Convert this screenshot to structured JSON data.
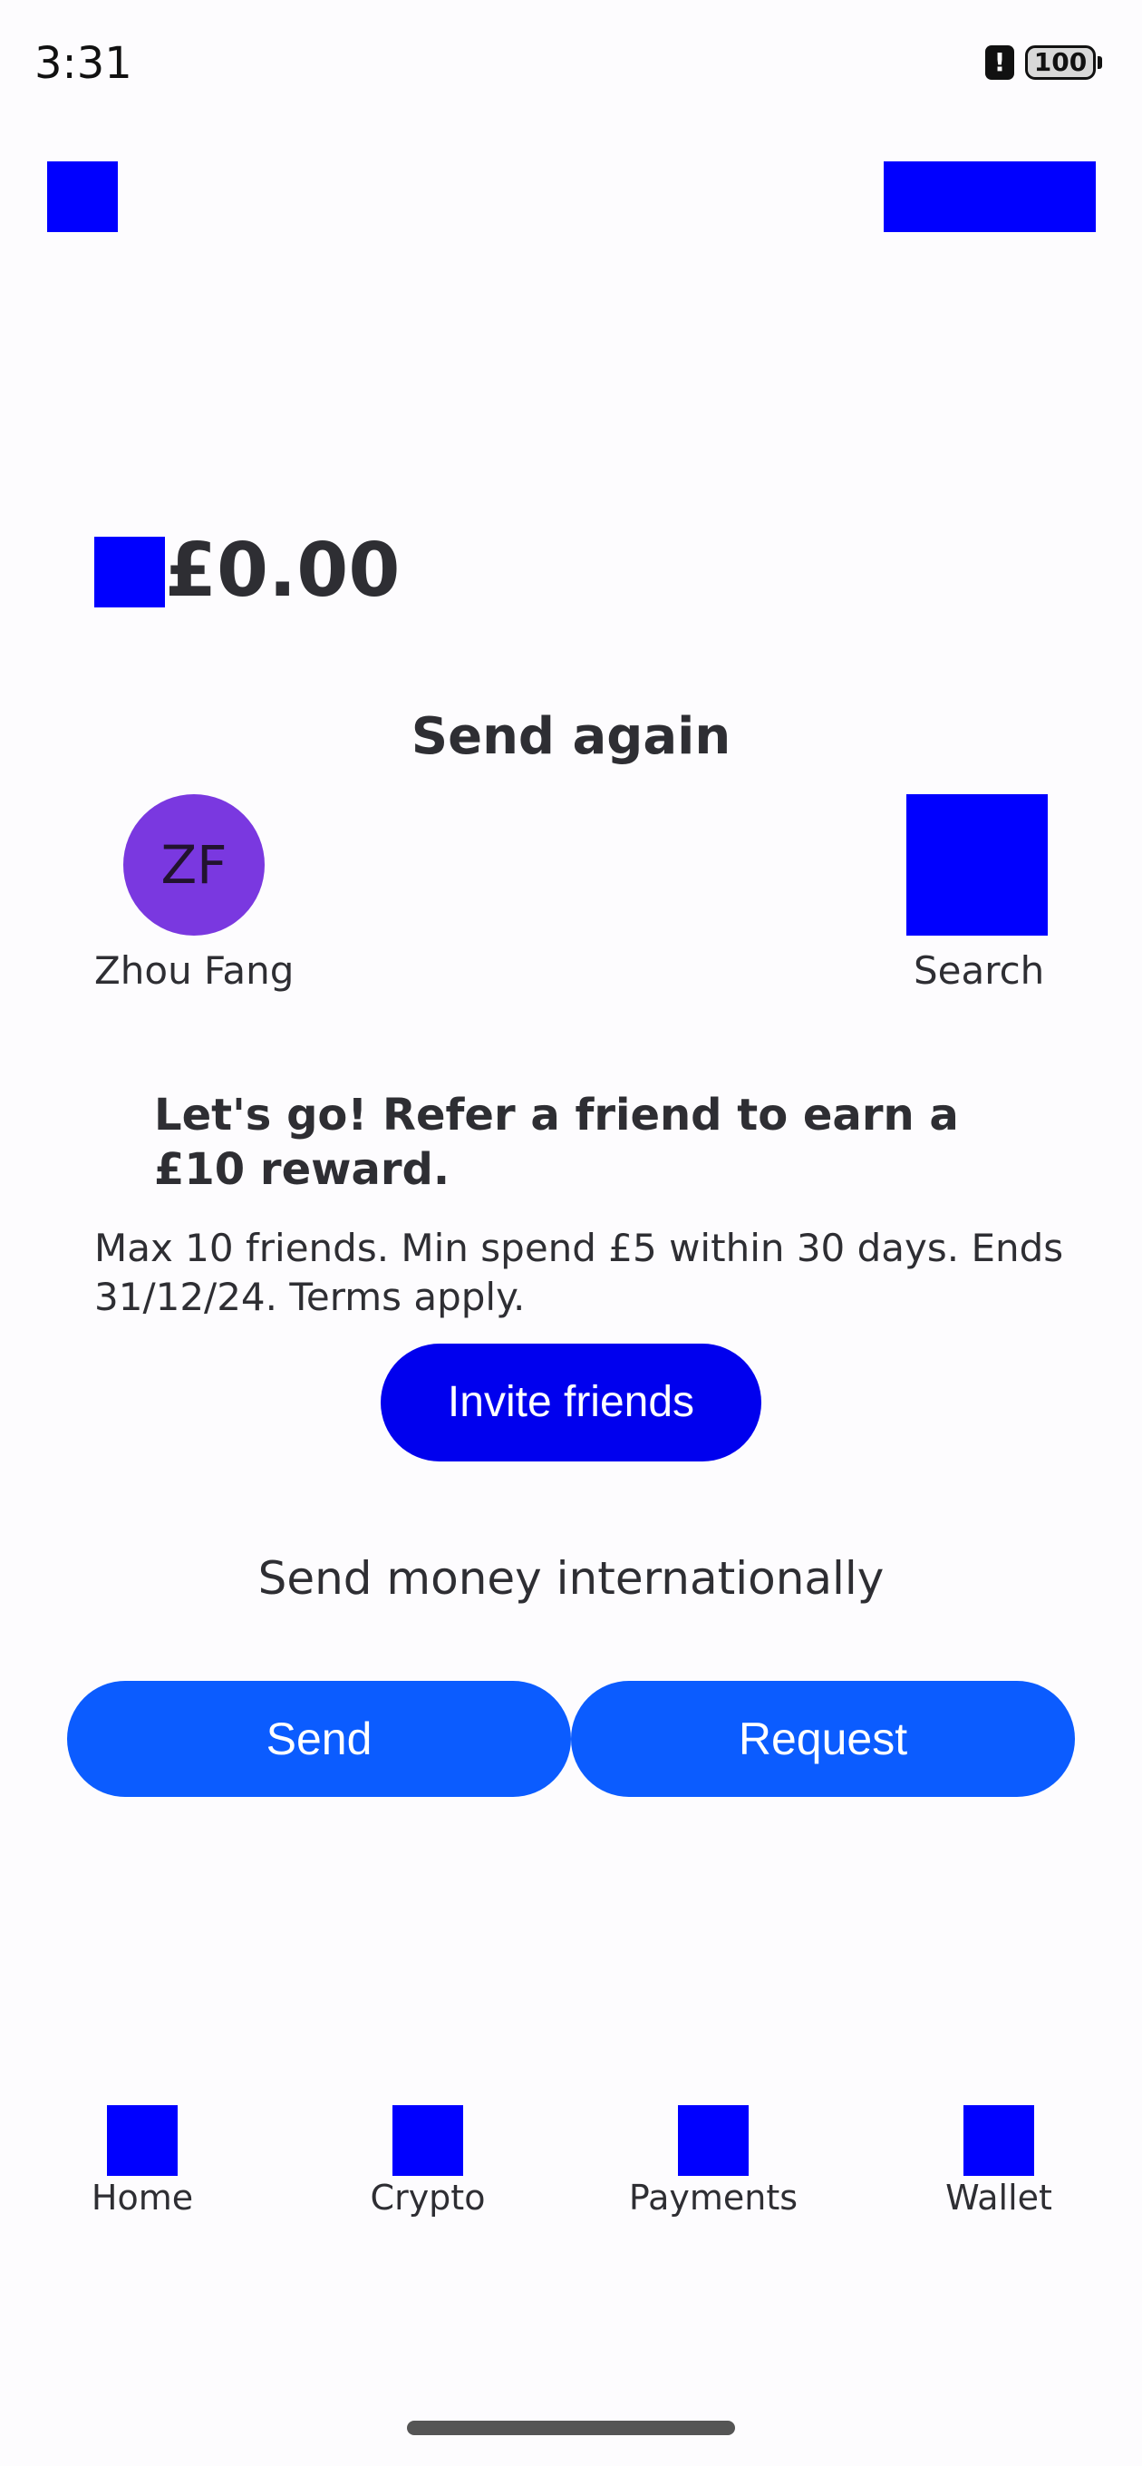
{
  "status_bar": {
    "time": "3:31",
    "battery": "100",
    "alert_glyph": "!"
  },
  "balance": {
    "amount": "£0.00"
  },
  "send_again": {
    "title": "Send again",
    "contacts": [
      {
        "initials": "ZF",
        "name": "Zhou Fang"
      }
    ],
    "search_label": "Search"
  },
  "promo": {
    "title": "Let's go! Refer a friend to earn a £10 reward.",
    "terms": "Max 10 friends. Min spend £5 within 30 days. Ends 31/12/24. Terms apply.",
    "button_label": "Invite friends"
  },
  "international": {
    "title": "Send money internationally",
    "send_label": "Send",
    "request_label": "Request"
  },
  "nav": {
    "items": [
      {
        "label": "Home"
      },
      {
        "label": "Crypto"
      },
      {
        "label": "Payments"
      },
      {
        "label": "Wallet"
      }
    ]
  },
  "colors": {
    "placeholder_blue": "#0000ff",
    "accent_blue": "#0b5cff",
    "invite_blue": "#0000ee",
    "avatar_purple": "#7a38e0",
    "text_dark": "#2e2e33"
  }
}
